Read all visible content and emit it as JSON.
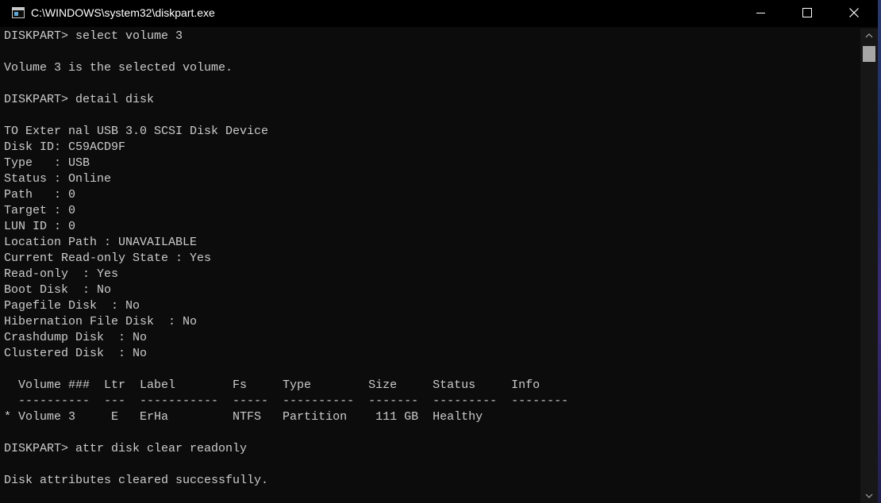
{
  "window": {
    "title": "C:\\WINDOWS\\system32\\diskpart.exe",
    "icon": "console-app-icon"
  },
  "caption_buttons": {
    "minimize": "minimize-icon",
    "maximize": "maximize-icon",
    "close": "close-icon"
  },
  "console": {
    "lines": [
      "DISKPART> select volume 3",
      "",
      "Volume 3 is the selected volume.",
      "",
      "DISKPART> detail disk",
      "",
      "TO Exter nal USB 3.0 SCSI Disk Device",
      "Disk ID: C59ACD9F",
      "Type   : USB",
      "Status : Online",
      "Path   : 0",
      "Target : 0",
      "LUN ID : 0",
      "Location Path : UNAVAILABLE",
      "Current Read-only State : Yes",
      "Read-only  : Yes",
      "Boot Disk  : No",
      "Pagefile Disk  : No",
      "Hibernation File Disk  : No",
      "Crashdump Disk  : No",
      "Clustered Disk  : No",
      "",
      "  Volume ###  Ltr  Label        Fs     Type        Size     Status     Info",
      "  ----------  ---  -----------  -----  ----------  -------  ---------  --------",
      "* Volume 3     E   ErHa         NTFS   Partition    111 GB  Healthy",
      "",
      "DISKPART> attr disk clear readonly",
      "",
      "Disk attributes cleared successfully."
    ]
  },
  "scrollbar": {
    "up_arrow": "chevron-up-icon",
    "down_arrow": "chevron-down-icon"
  },
  "colors": {
    "console_background": "#0c0c0c",
    "console_text": "#cccccc",
    "titlebar_background": "#000000",
    "titlebar_text": "#ffffff"
  }
}
